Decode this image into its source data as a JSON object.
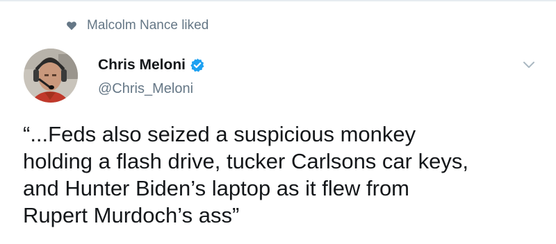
{
  "social_context": {
    "icon": "heart-icon",
    "text": "Malcolm Nance liked"
  },
  "author": {
    "name": "Chris Meloni",
    "handle": "@Chris_Meloni",
    "verified": true
  },
  "tweet": {
    "text": "“...Feds also seized a suspicious monkey\nholding a flash drive, tucker Carlsons car keys,\nand Hunter Biden’s laptop as it flew from\nRupert Murdoch’s ass”"
  },
  "colors": {
    "text_primary": "#14171a",
    "text_secondary": "#657786",
    "verified_blue": "#1da1f2",
    "caret": "#aab8c2"
  }
}
